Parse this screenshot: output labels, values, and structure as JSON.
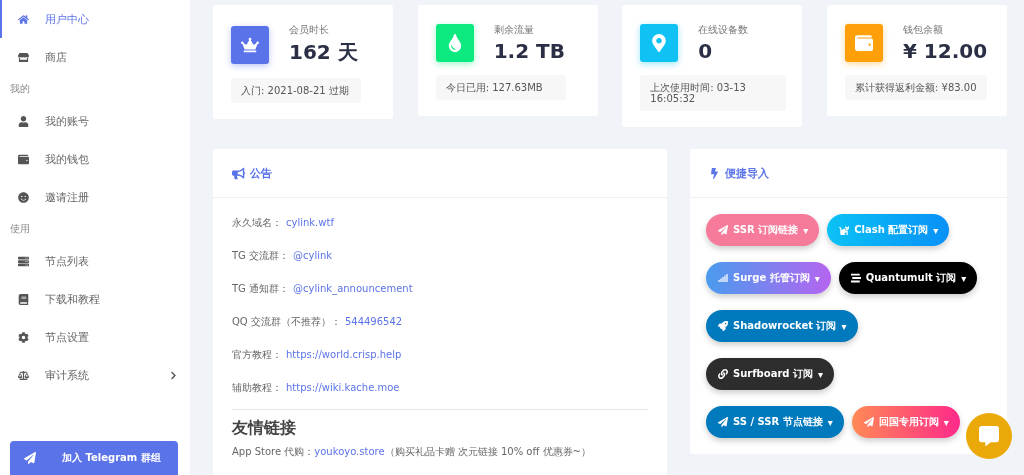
{
  "sidebar": {
    "entries": [
      {
        "kind": "link",
        "label": "用户中心",
        "selected": true,
        "expandable": false
      },
      {
        "kind": "link",
        "label": "商店",
        "selected": false,
        "expandable": false
      },
      {
        "kind": "heading",
        "label": "我的"
      },
      {
        "kind": "link",
        "label": "我的账号",
        "selected": false,
        "expandable": false
      },
      {
        "kind": "link",
        "label": "我的钱包",
        "selected": false,
        "expandable": false
      },
      {
        "kind": "link",
        "label": "邀请注册",
        "selected": false,
        "expandable": false
      },
      {
        "kind": "heading",
        "label": "使用"
      },
      {
        "kind": "link",
        "label": "节点列表",
        "selected": false,
        "expandable": false
      },
      {
        "kind": "link",
        "label": "下载和教程",
        "selected": false,
        "expandable": false
      },
      {
        "kind": "link",
        "label": "节点设置",
        "selected": false,
        "expandable": false
      },
      {
        "kind": "link",
        "label": "审计系统",
        "selected": false,
        "expandable": true
      }
    ],
    "telegram_button": "加入 Telegram 群组"
  },
  "stats": [
    {
      "label": "会员时长",
      "value": "162 天",
      "note": "入门: 2021-08-21 过期",
      "color": "#5b73e8"
    },
    {
      "label": "剩余流量",
      "value": "1.2 TB",
      "note": "今日已用: 127.63MB",
      "color": "#0ce97f"
    },
    {
      "label": "在线设备数",
      "value": "0",
      "note": "上次使用时间: 03-13 16:05:32",
      "color": "#10c2f4"
    },
    {
      "label": "钱包余额",
      "value": "¥ 12.00",
      "note": "累计获得返利金额: ¥83.00",
      "color": "#ff9f0a"
    }
  ],
  "announcement": {
    "title": "公告",
    "rows": [
      {
        "label": "永久域名：",
        "value": "cylink.wtf"
      },
      {
        "label": "TG 交流群：",
        "value": "@cylink"
      },
      {
        "label": "TG 通知群：",
        "value": "@cylink_announcement"
      },
      {
        "label": "QQ 交流群（不推荐）：",
        "value": "544496542"
      },
      {
        "label": "官方教程：",
        "value": "https://world.crisp.help"
      },
      {
        "label": "辅助教程：",
        "value": "https://wiki.kache.moe"
      }
    ],
    "friends_title": "友情链接",
    "friends_line": {
      "label": "App Store 代购：",
      "link": "youkoyo.store",
      "note": "（购买礼品卡赠 次元链接 10% off 优惠券~）"
    }
  },
  "quick_import": {
    "title": "便捷导入",
    "buttons": [
      {
        "label": "SSR 订阅链接",
        "kind": "pink",
        "caret": "▾"
      },
      {
        "label": "Clash 配置订阅",
        "kind": "cyan",
        "caret": "▾"
      },
      {
        "label": "Surge 托管订阅",
        "kind": "violet",
        "caret": "▾"
      },
      {
        "label": "Quantumult 订阅",
        "kind": "black",
        "caret": "▾"
      },
      {
        "label": "Shadowrocket 订阅",
        "kind": "blue",
        "caret": "▾"
      },
      {
        "label": "Surfboard 订阅",
        "kind": "dark",
        "caret": "▾"
      },
      {
        "label": "SS / SSR 节点链接",
        "kind": "blue",
        "caret": "▾"
      },
      {
        "label": "回国专用订阅",
        "kind": "sunset",
        "caret": "▾"
      }
    ]
  }
}
